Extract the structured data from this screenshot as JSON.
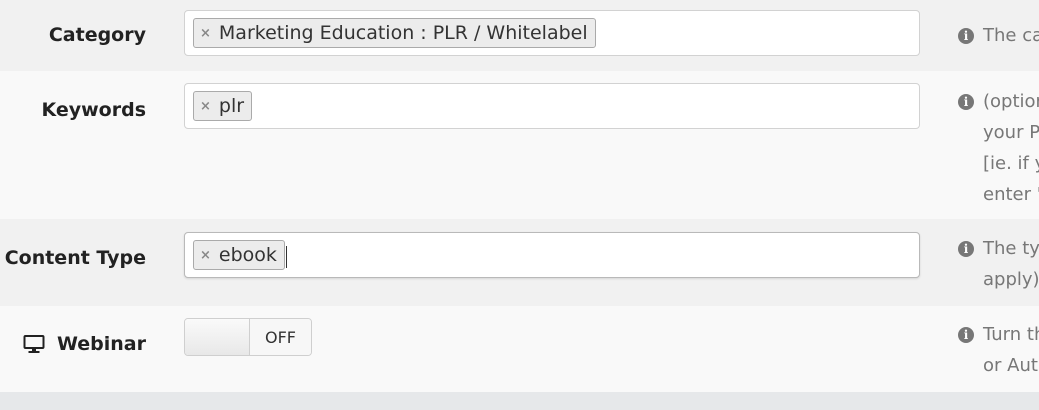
{
  "rows": {
    "category": {
      "label": "Category",
      "tags": [
        "Marketing Education : PLR / Whitelabel"
      ],
      "help": [
        "The ca"
      ]
    },
    "keywords": {
      "label": "Keywords",
      "tags": [
        "plr"
      ],
      "help": [
        "(optior",
        "your P",
        "[ie. if y",
        "enter '"
      ]
    },
    "content_type": {
      "label": "Content Type",
      "tags": [
        "ebook"
      ],
      "help": [
        "The ty",
        "apply)"
      ]
    },
    "webinar": {
      "label": "Webinar",
      "icon": "monitor-icon",
      "toggle_state": "OFF",
      "help": [
        "Turn th",
        "or Aut"
      ]
    }
  },
  "chip_remove_glyph": "×",
  "info_glyph": "i"
}
